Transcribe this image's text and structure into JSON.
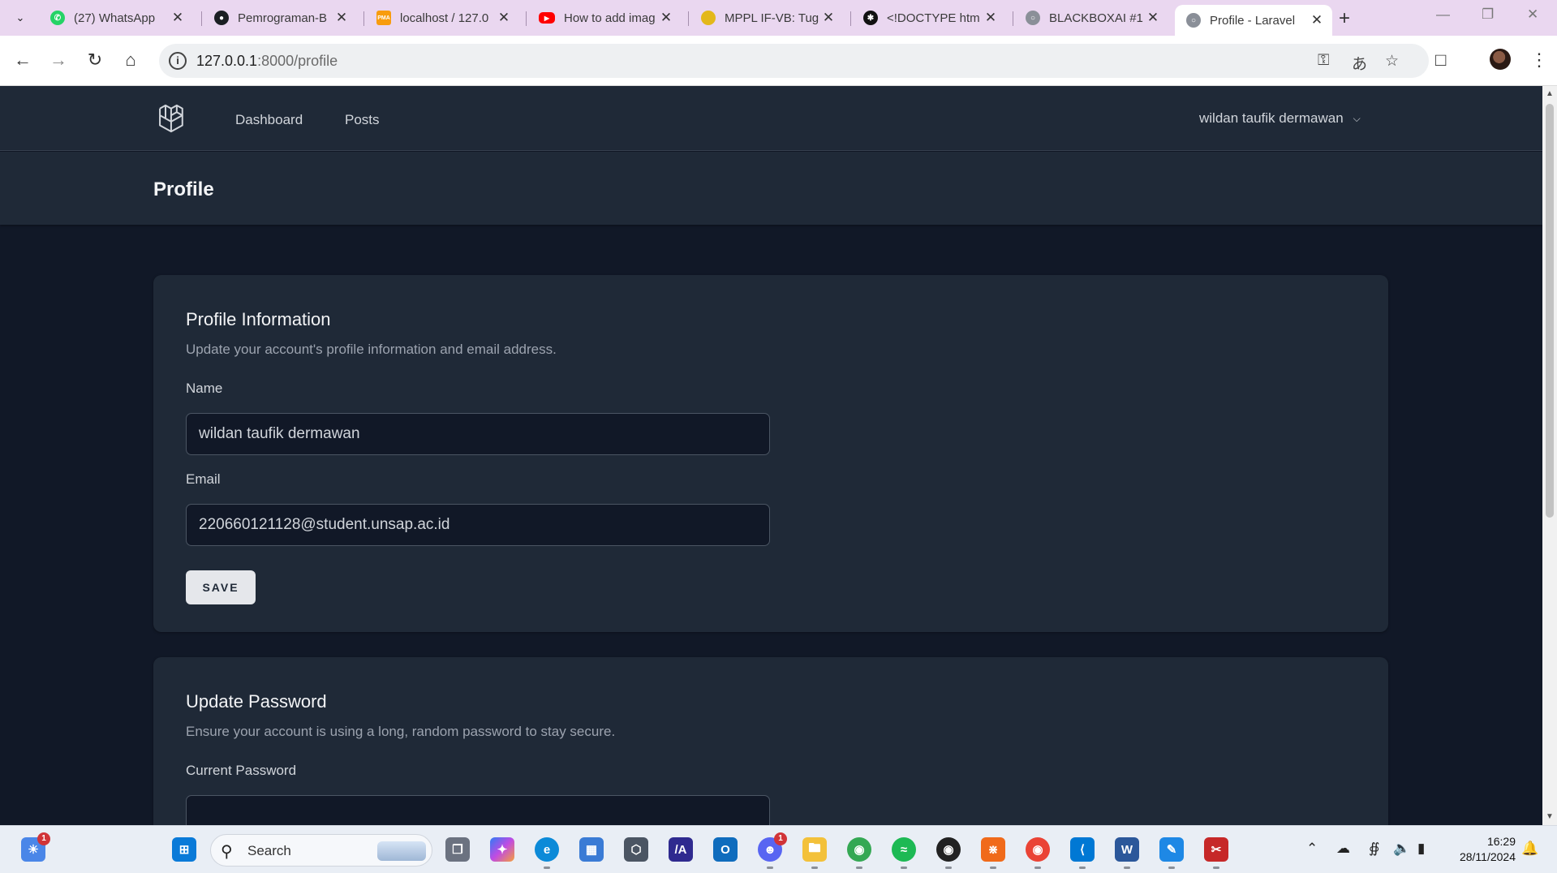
{
  "browser": {
    "tabs": [
      {
        "title": "(27) WhatsApp",
        "icon": "whatsapp-icon",
        "color": "#25d366"
      },
      {
        "title": "Pemrograman-B",
        "icon": "github-icon",
        "color": "#1b1f23"
      },
      {
        "title": "localhost / 127.0",
        "icon": "phpmyadmin-icon",
        "color": "#f89c0e"
      },
      {
        "title": "How to add imag",
        "icon": "youtube-icon",
        "color": "#ff0000"
      },
      {
        "title": "MPPL IF-VB: Tug",
        "icon": "moodle-icon",
        "color": "#e3b81a"
      },
      {
        "title": "<!DOCTYPE htm",
        "icon": "chatgpt-icon",
        "color": "#111111"
      },
      {
        "title": "BLACKBOXAI #1",
        "icon": "globe-icon",
        "color": "#8a8f98"
      },
      {
        "title": "Profile - Laravel",
        "icon": "globe-icon",
        "color": "#8a8f98",
        "active": true
      }
    ],
    "url_host": "127.0.0.1",
    "url_path": ":8000/profile"
  },
  "app": {
    "nav": {
      "links": [
        "Dashboard",
        "Posts"
      ],
      "user_name": "wildan taufik dermawan"
    },
    "page_title": "Profile",
    "profile_info": {
      "heading": "Profile Information",
      "description": "Update your account's profile information and email address.",
      "name_label": "Name",
      "name_value": "wildan taufik dermawan",
      "email_label": "Email",
      "email_value": "220660121128@student.unsap.ac.id",
      "save_label": "SAVE"
    },
    "update_password": {
      "heading": "Update Password",
      "description": "Ensure your account is using a long, random password to stay secure.",
      "current_password_label": "Current Password",
      "current_password_value": ""
    }
  },
  "taskbar": {
    "search_label": "Search",
    "widgets_badge": "1",
    "discord_badge": "1",
    "time": "16:29",
    "date": "28/11/2024"
  }
}
